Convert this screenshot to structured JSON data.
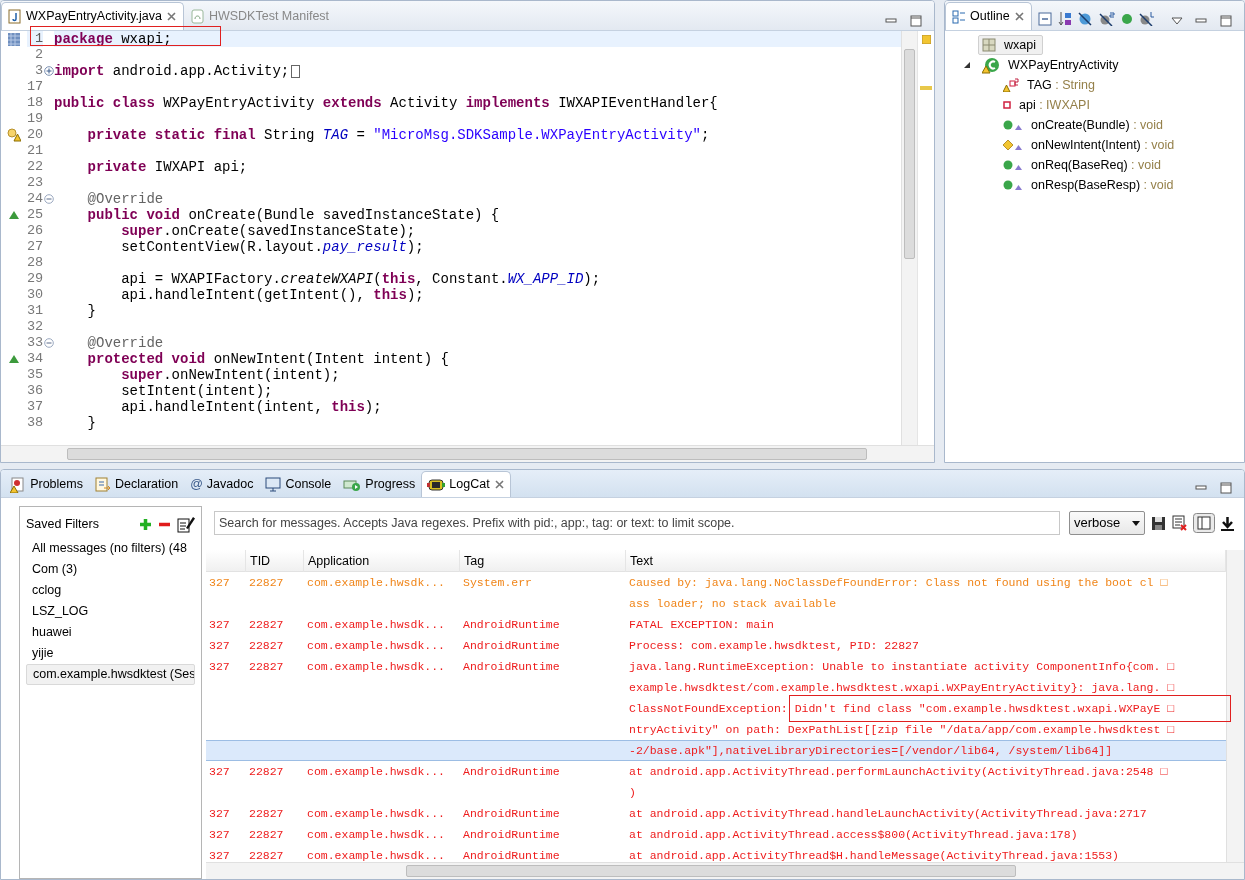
{
  "editor": {
    "tabs": [
      {
        "label": "WXPayEntryActivity.java",
        "selected": true,
        "closable": true
      },
      {
        "label": "HWSDKTest Manifest",
        "selected": false,
        "closable": false
      }
    ],
    "lines": [
      {
        "number": "1",
        "current": true,
        "segments": [
          {
            "kind": "keyword",
            "text": "package "
          },
          {
            "kind": "plain",
            "text": "wxapi;"
          }
        ]
      },
      {
        "number": "2",
        "current": false
      },
      {
        "number": "3",
        "current": false,
        "collapsed": true,
        "segments": [
          {
            "kind": "keyword",
            "text": "import "
          },
          {
            "kind": "plain",
            "text": "android.app.Activity;"
          }
        ]
      },
      {
        "number": "17",
        "current": false
      },
      {
        "number": "18",
        "current": false,
        "segments": [
          {
            "kind": "keyword",
            "text": "public class "
          },
          {
            "kind": "plain",
            "text": "WXPayEntryActivity "
          },
          {
            "kind": "keyword",
            "text": "extends "
          },
          {
            "kind": "plain",
            "text": "Activity "
          },
          {
            "kind": "keyword",
            "text": "implements "
          },
          {
            "kind": "plain",
            "text": "IWXAPIEventHandler{"
          }
        ]
      },
      {
        "number": "19",
        "current": false
      },
      {
        "number": "20",
        "current": false,
        "warning": true,
        "segments": [
          {
            "kind": "keyword",
            "text": "    private static final "
          },
          {
            "kind": "plain",
            "text": "String "
          },
          {
            "kind": "field",
            "text": "TAG"
          },
          {
            "kind": "plain",
            "text": " = "
          },
          {
            "kind": "string",
            "text": "\"MicroMsg.SDKSample.WXPayEntryActivity\""
          },
          {
            "kind": "plain",
            "text": ";"
          }
        ]
      },
      {
        "number": "21",
        "current": false
      },
      {
        "number": "22",
        "current": false,
        "segments": [
          {
            "kind": "keyword",
            "text": "    private "
          },
          {
            "kind": "plain",
            "text": "IWXAPI api;"
          }
        ]
      },
      {
        "number": "23",
        "current": false
      },
      {
        "number": "24",
        "current": false,
        "collapsed": false,
        "segments": [
          {
            "kind": "annotation",
            "text": "    @Override"
          }
        ]
      },
      {
        "number": "25",
        "current": false,
        "override": true,
        "segments": [
          {
            "kind": "keyword",
            "text": "    public void "
          },
          {
            "kind": "plain",
            "text": "onCreate(Bundle savedInstanceState) {"
          }
        ]
      },
      {
        "number": "26",
        "current": false,
        "segments": [
          {
            "kind": "keyword",
            "text": "        super"
          },
          {
            "kind": "plain",
            "text": ".onCreate(savedInstanceState);"
          }
        ]
      },
      {
        "number": "27",
        "current": false,
        "segments": [
          {
            "kind": "plain",
            "text": "        setContentView(R.layout."
          },
          {
            "kind": "field",
            "text": "pay_result"
          },
          {
            "kind": "plain",
            "text": ");"
          }
        ]
      },
      {
        "number": "28",
        "current": false
      },
      {
        "number": "29",
        "current": false,
        "segments": [
          {
            "kind": "plain",
            "text": "        api = WXAPIFactory."
          },
          {
            "kind": "static-method",
            "text": "createWXAPI"
          },
          {
            "kind": "plain",
            "text": "("
          },
          {
            "kind": "keyword",
            "text": "this"
          },
          {
            "kind": "plain",
            "text": ", Constant."
          },
          {
            "kind": "field",
            "text": "WX_APP_ID"
          },
          {
            "kind": "plain",
            "text": ");"
          }
        ]
      },
      {
        "number": "30",
        "current": false,
        "segments": [
          {
            "kind": "plain",
            "text": "        api.handleIntent(getIntent(), "
          },
          {
            "kind": "keyword",
            "text": "this"
          },
          {
            "kind": "plain",
            "text": ");"
          }
        ]
      },
      {
        "number": "31",
        "current": false,
        "segments": [
          {
            "kind": "plain",
            "text": "    }"
          }
        ]
      },
      {
        "number": "32",
        "current": false
      },
      {
        "number": "33",
        "current": false,
        "collapsed": false,
        "segments": [
          {
            "kind": "annotation",
            "text": "    @Override"
          }
        ]
      },
      {
        "number": "34",
        "current": false,
        "override": true,
        "segments": [
          {
            "kind": "keyword",
            "text": "    protected void "
          },
          {
            "kind": "plain",
            "text": "onNewIntent(Intent intent) {"
          }
        ]
      },
      {
        "number": "35",
        "current": false,
        "segments": [
          {
            "kind": "keyword",
            "text": "        super"
          },
          {
            "kind": "plain",
            "text": ".onNewIntent(intent);"
          }
        ]
      },
      {
        "number": "36",
        "current": false,
        "segments": [
          {
            "kind": "plain",
            "text": "        setIntent(intent);"
          }
        ]
      },
      {
        "number": "37",
        "current": false,
        "segments": [
          {
            "kind": "plain",
            "text": "        api.handleIntent(intent, "
          },
          {
            "kind": "keyword",
            "text": "this"
          },
          {
            "kind": "plain",
            "text": ");"
          }
        ]
      },
      {
        "number": "38",
        "current": false,
        "segments": [
          {
            "kind": "plain",
            "text": "    }"
          }
        ]
      }
    ]
  },
  "outline": {
    "title": "Outline",
    "items": [
      {
        "name": "wxapi",
        "kind": "package",
        "selected": true
      },
      {
        "name": "WXPayEntryActivity",
        "kind": "class",
        "selected": false,
        "expanded": true,
        "children": [
          {
            "name": "TAG",
            "type": " : String",
            "kind": "static-field",
            "selected": false
          },
          {
            "name": "api",
            "type": " : IWXAPI",
            "kind": "private-field",
            "selected": false
          },
          {
            "name": "onCreate(Bundle)",
            "type": " : void",
            "kind": "public-method",
            "selected": false
          },
          {
            "name": "onNewIntent(Intent)",
            "type": " : void",
            "kind": "protected-method",
            "selected": false
          },
          {
            "name": "onReq(BaseReq)",
            "type": " : void",
            "kind": "public-method",
            "selected": false
          },
          {
            "name": "onResp(BaseResp)",
            "type": " : void",
            "kind": "public-method",
            "selected": false
          }
        ]
      }
    ]
  },
  "bottom_tabs": [
    {
      "label": "Problems",
      "selected": false
    },
    {
      "label": "Declaration",
      "selected": false
    },
    {
      "label": "Javadoc",
      "symbol": "@",
      "selected": false
    },
    {
      "label": "Console",
      "selected": false
    },
    {
      "label": "Progress",
      "selected": false
    },
    {
      "label": "LogCat",
      "selected": true
    }
  ],
  "saved_filters": {
    "title": "Saved Filters",
    "items": [
      {
        "label": "All messages (no filters) (48",
        "selected": false
      },
      {
        "label": "Com (3)",
        "selected": false
      },
      {
        "label": "cclog",
        "selected": false
      },
      {
        "label": "LSZ_LOG",
        "selected": false
      },
      {
        "label": "huawei",
        "selected": false
      },
      {
        "label": "yijie",
        "selected": false
      },
      {
        "label": "com.example.hwsdktest (Ses",
        "selected": true
      }
    ]
  },
  "search": {
    "placeholder": "Search for messages. Accepts Java regexes. Prefix with pid:, app:, tag: or text: to limit scope."
  },
  "log_level": "verbose",
  "table": {
    "columns": [
      "TID",
      "Application",
      "Tag",
      "Text"
    ],
    "rows": [
      {
        "column_1": "327",
        "tid": "22827",
        "application": "com.example.hwsdk...",
        "tag": "System.err",
        "color": "#f08519",
        "selected": false,
        "text_lines": [
          "Caused by: java.lang.NoClassDefFoundError: Class not found using the boot cl □",
          "ass loader; no stack available"
        ]
      },
      {
        "column_1": "327",
        "tid": "22827",
        "application": "com.example.hwsdk...",
        "tag": "AndroidRuntime",
        "color": "#ee1c1c",
        "selected": false,
        "text_lines": [
          "FATAL EXCEPTION: main"
        ]
      },
      {
        "column_1": "327",
        "tid": "22827",
        "application": "com.example.hwsdk...",
        "tag": "AndroidRuntime",
        "color": "#ee1c1c",
        "selected": false,
        "text_lines": [
          "Process: com.example.hwsdktest, PID: 22827"
        ]
      },
      {
        "column_1": "327",
        "tid": "22827",
        "application": "com.example.hwsdk...",
        "tag": "AndroidRuntime",
        "color": "#ee1c1c",
        "selected": true,
        "text_lines": [
          "java.lang.RuntimeException: Unable to instantiate activity ComponentInfo{com. □",
          "example.hwsdktest/com.example.hwsdktest.wxapi.WXPayEntryActivity}: java.lang. □",
          "ClassNotFoundException: Didn't find class \"com.example.hwsdktest.wxapi.WXPayE □",
          "ntryActivity\" on path: DexPathList[[zip file \"/data/app/com.example.hwsdktest □",
          "-2/base.apk\"],nativeLibraryDirectories=[/vendor/lib64, /system/lib64]]"
        ]
      },
      {
        "column_1": "327",
        "tid": "22827",
        "application": "com.example.hwsdk...",
        "tag": "AndroidRuntime",
        "color": "#ee1c1c",
        "selected": false,
        "text_lines": [
          "at android.app.ActivityThread.performLaunchActivity(ActivityThread.java:2548 □",
          ")"
        ]
      },
      {
        "column_1": "327",
        "tid": "22827",
        "application": "com.example.hwsdk...",
        "tag": "AndroidRuntime",
        "color": "#ee1c1c",
        "selected": false,
        "text_lines": [
          "at android.app.ActivityThread.handleLaunchActivity(ActivityThread.java:2717"
        ]
      },
      {
        "column_1": "327",
        "tid": "22827",
        "application": "com.example.hwsdk...",
        "tag": "AndroidRuntime",
        "color": "#ee1c1c",
        "selected": false,
        "text_lines": [
          "at android.app.ActivityThread.access$800(ActivityThread.java:178)"
        ]
      },
      {
        "column_1": "327",
        "tid": "22827",
        "application": "com.example.hwsdk...",
        "tag": "AndroidRuntime",
        "color": "#ee1c1c",
        "selected": false,
        "text_lines": [
          "at android.app.ActivityThread$H.handleMessage(ActivityThread.java:1553)"
        ]
      }
    ]
  }
}
